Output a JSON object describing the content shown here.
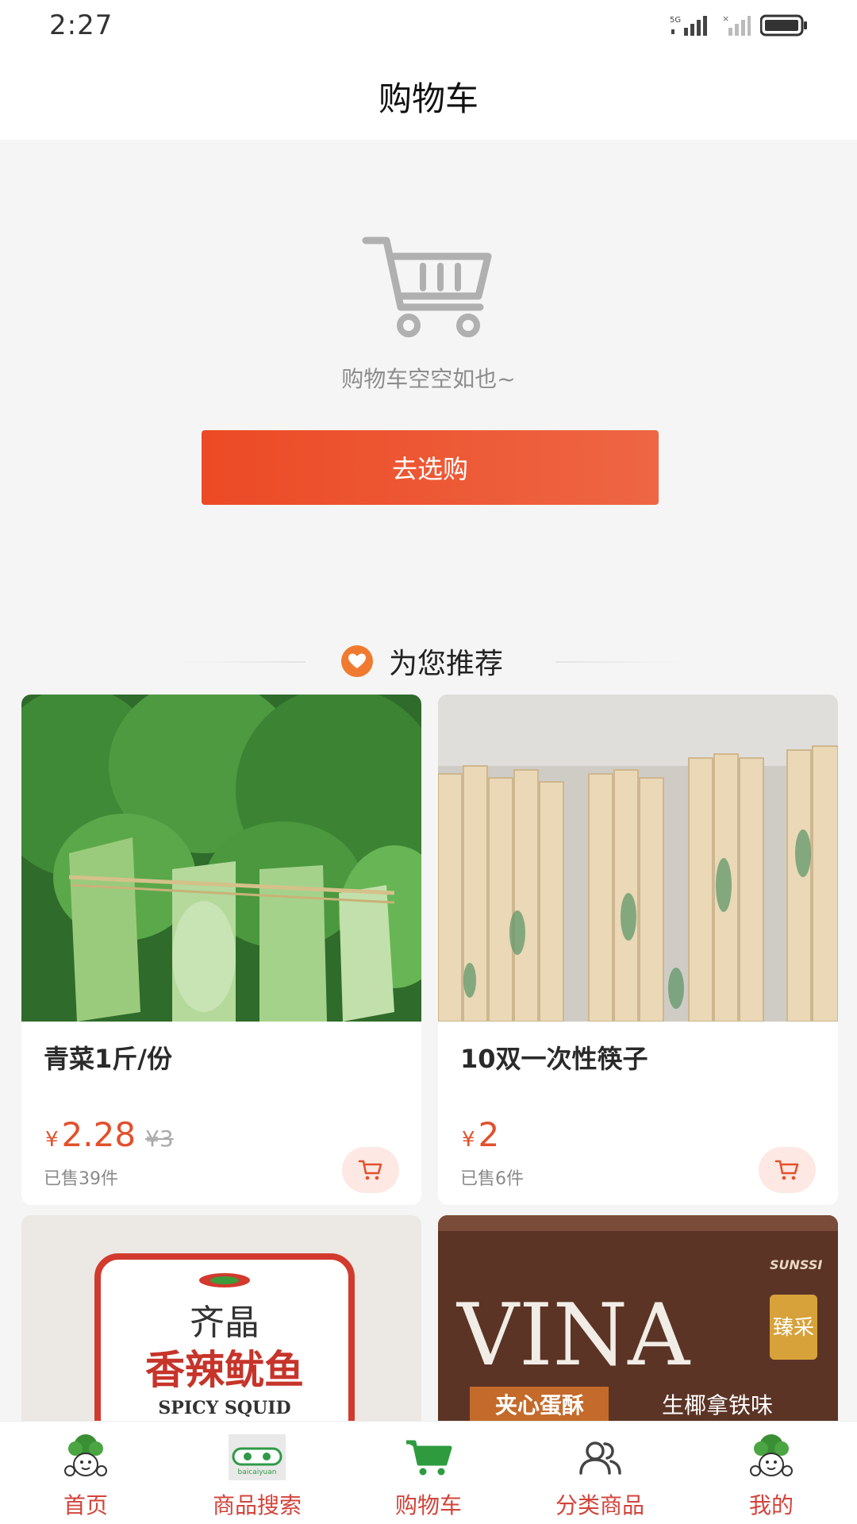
{
  "status_bar": {
    "time": "2:27",
    "network": "5G"
  },
  "header": {
    "title": "购物车"
  },
  "empty_cart": {
    "message": "购物车空空如也~",
    "button_label": "去选购",
    "accent": "#ec4a25"
  },
  "recommend": {
    "title": "为您推荐",
    "items": [
      {
        "name": "青菜1斤/份",
        "currency": "¥",
        "price": "2.28",
        "original_price": "¥3",
        "sold": "已售39件"
      },
      {
        "name": "10双一次性筷子",
        "currency": "¥",
        "price": "2",
        "original_price": "",
        "sold": "已售6件"
      },
      {
        "name": "",
        "image_text_brand": "齐晶",
        "image_text_main": "香辣鱿鱼",
        "image_text_en": "SPICY SQUID"
      },
      {
        "name": "",
        "image_text_brand": "VINA",
        "image_text_tag": "臻采",
        "image_text_sub1": "夹心蛋酥",
        "image_text_sub2": "生椰拿铁味",
        "image_text_logo": "SUNSSI"
      }
    ]
  },
  "bottom_nav": {
    "items": [
      {
        "label": "首页",
        "icon": "mascot-icon"
      },
      {
        "label": "商品搜索",
        "icon": "brand-logo-icon",
        "logo_text": "baicaiyuan"
      },
      {
        "label": "购物车",
        "icon": "cart-icon"
      },
      {
        "label": "分类商品",
        "icon": "users-icon"
      },
      {
        "label": "我的",
        "icon": "mascot-icon"
      }
    ],
    "label_color": "#d2443b"
  }
}
